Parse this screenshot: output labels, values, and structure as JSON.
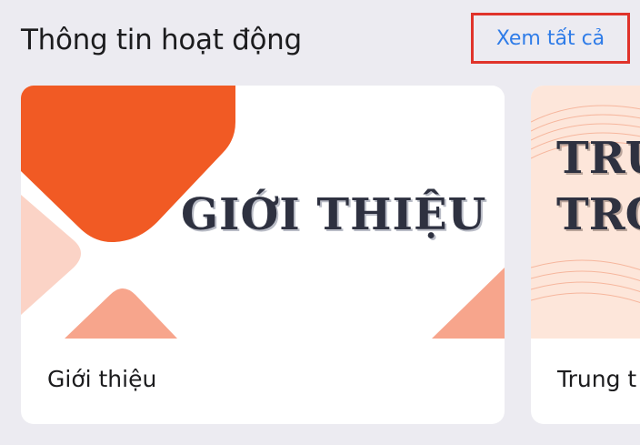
{
  "header": {
    "title": "Thông tin hoạt động",
    "see_all_label": "Xem tất cả"
  },
  "cards": [
    {
      "banner_text": "GIỚI THIỆU",
      "caption": "Giới thiệu"
    },
    {
      "banner_line_1": "TRU",
      "banner_line_2": "TRO",
      "caption": "Trung t"
    }
  ],
  "colors": {
    "background": "#ecebf1",
    "accent_orange": "#f15a24",
    "link_blue": "#2f7ce8",
    "highlight_red": "#e0332b"
  }
}
